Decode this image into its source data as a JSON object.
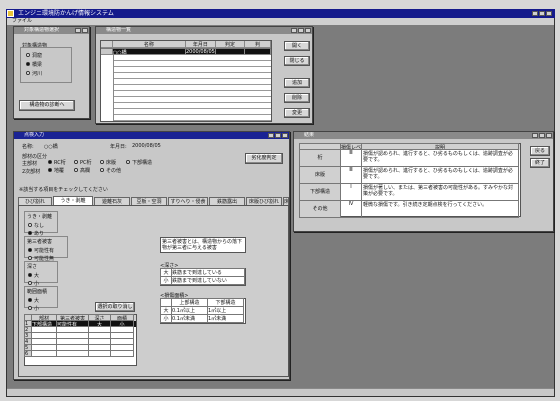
{
  "app": {
    "title": "エンジニ環境防かんげ情報システム",
    "menu": [
      "ファイル"
    ]
  },
  "selection_window": {
    "title": "対象構造物選択",
    "group_label": "対象構造物",
    "options": [
      {
        "label": "洞窟",
        "checked": false
      },
      {
        "label": "橋梁",
        "checked": true
      },
      {
        "label": "河川",
        "checked": false
      }
    ],
    "analyze_button": "構造物の診断へ"
  },
  "list_window": {
    "title": "構造物一覧",
    "columns": [
      "名称",
      "年月日",
      "判定",
      "判"
    ],
    "rows": [
      [
        "○○橋",
        "2000/08/05",
        "",
        ""
      ]
    ],
    "buttons": [
      "開く",
      "閉じる",
      "追加",
      "削除",
      "変更"
    ]
  },
  "inspection_window": {
    "title": "点検入力",
    "name_label": "名称:",
    "name_value": "○○橋",
    "date_label": "年月日:",
    "date_value": "2000/08/05",
    "type_label": "部材の区分",
    "main_label": "主部材",
    "main_options": [
      {
        "label": "RC桁",
        "checked": true
      },
      {
        "label": "PC桁",
        "checked": false
      },
      {
        "label": "床版",
        "checked": false
      },
      {
        "label": "下部構造",
        "checked": false
      }
    ],
    "secondary_label": "2次部材",
    "secondary_options": [
      {
        "label": "地覆",
        "checked": true
      },
      {
        "label": "高欄",
        "checked": false
      },
      {
        "label": "その他",
        "checked": false
      }
    ],
    "judge_button": "劣化度判定",
    "instruction": "※該当する項目をチェックしてください",
    "tabs": [
      "ひび割れ",
      "うき・剥離",
      "遊離石灰",
      "豆板・空洞",
      "すりへり・侵食",
      "鉄筋露出",
      "床版ひび割れ",
      "床版抜け落ち"
    ],
    "selected_tab": 1,
    "groups": [
      {
        "label": "うき・剥離",
        "options": [
          {
            "label": "なし",
            "checked": false
          },
          {
            "label": "あり",
            "checked": true
          }
        ]
      },
      {
        "label": "第三者被害",
        "options": [
          {
            "label": "可能性有",
            "checked": true
          },
          {
            "label": "可能性無",
            "checked": false
          }
        ]
      },
      {
        "label": "深さ",
        "options": [
          {
            "label": "大",
            "checked": true
          },
          {
            "label": "小",
            "checked": false
          }
        ]
      },
      {
        "label": "範囲面積",
        "options": [
          {
            "label": "大",
            "checked": true
          },
          {
            "label": "小",
            "checked": false
          }
        ]
      }
    ],
    "delete_button": "選択の取り消し",
    "table_headers": [
      "部材",
      "第三者被害",
      "深さ",
      "面積"
    ],
    "table_rows": [
      [
        "下部構造",
        "可能性有",
        "大",
        "小"
      ],
      [
        "",
        "",
        "",
        ""
      ],
      [
        "",
        "",
        "",
        ""
      ],
      [
        "",
        "",
        "",
        ""
      ],
      [
        "",
        "",
        "",
        ""
      ],
      [
        "",
        "",
        "",
        ""
      ]
    ],
    "row_numbers": [
      "1",
      "2",
      "3",
      "4",
      "5",
      "6"
    ],
    "description": "第三者被害とは、構造物からの落下物が第三者に与える被害",
    "depth_title": "<深さ>",
    "depth_rows": [
      [
        "大",
        "鉄筋まで到達している"
      ],
      [
        "小",
        "鉄筋まで到達していない"
      ]
    ],
    "area_title": "<損傷面積>",
    "area_headers": [
      "",
      "上部構造",
      "下部構造"
    ],
    "area_rows": [
      [
        "大",
        "0.1㎡以上",
        "1㎡以上"
      ],
      [
        "小",
        "0.1㎡未満",
        "1㎡未満"
      ]
    ]
  },
  "result_window": {
    "title": "結果",
    "headers": [
      "",
      "損傷レベル",
      "説明"
    ],
    "rows": [
      {
        "category": "桁",
        "level": "Ⅲ",
        "text": "損傷が認められ、進行すると、ひ劣るものもしくは、追跡調査が必要です。"
      },
      {
        "category": "床版",
        "level": "Ⅲ",
        "text": "損傷が認められ、進行すると、ひ劣るものもしくは、追跡調査が必要です。"
      },
      {
        "category": "下部構造",
        "level": "Ⅰ",
        "text": "損傷が著しい、または、第三者被害の可能性がある。すみやかな対策が必要です。"
      },
      {
        "category": "その他",
        "level": "Ⅳ",
        "text": "軽微な損傷です。引き続き定期点検を行ってください。"
      }
    ],
    "buttons": [
      "戻る",
      "終了"
    ]
  }
}
